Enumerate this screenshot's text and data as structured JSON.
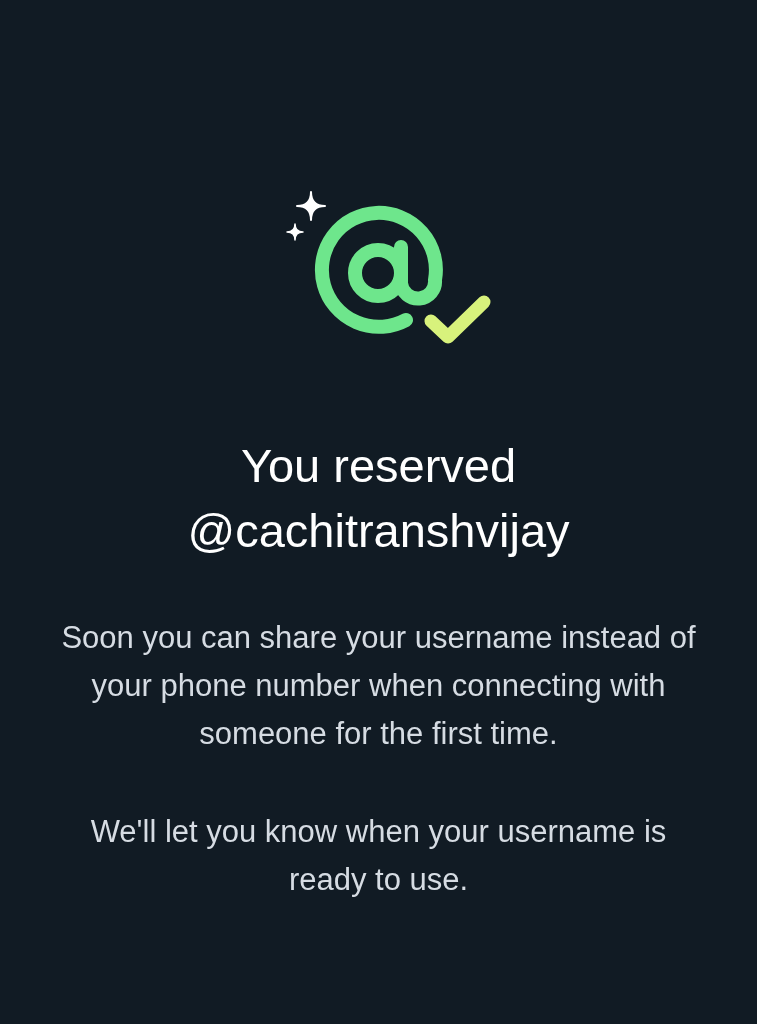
{
  "title": "You reserved @cachitranshvijay",
  "paragraphs": [
    "Soon you can share your username instead of your phone number when connecting with someone for the first time.",
    "We'll let you know when your username is ready to use."
  ]
}
